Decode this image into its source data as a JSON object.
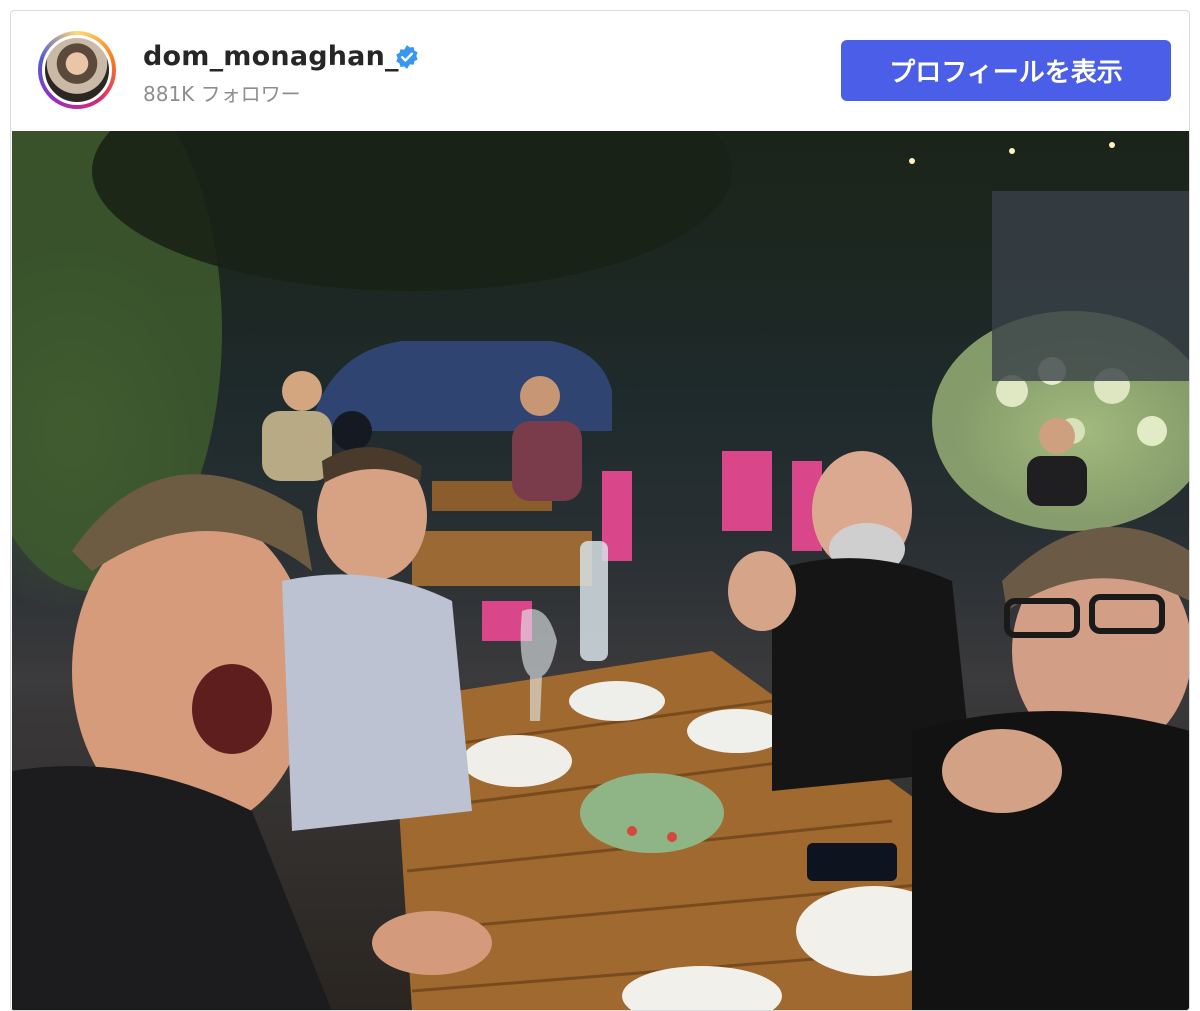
{
  "post": {
    "username": "dom_monaghan_",
    "followers": "881K フォロワー",
    "profile_button": "プロフィールを表示",
    "accent_color": "#4a5ee8",
    "verified_color": "#3897f0"
  },
  "photo": {
    "subject": "group-dinner-photo"
  }
}
